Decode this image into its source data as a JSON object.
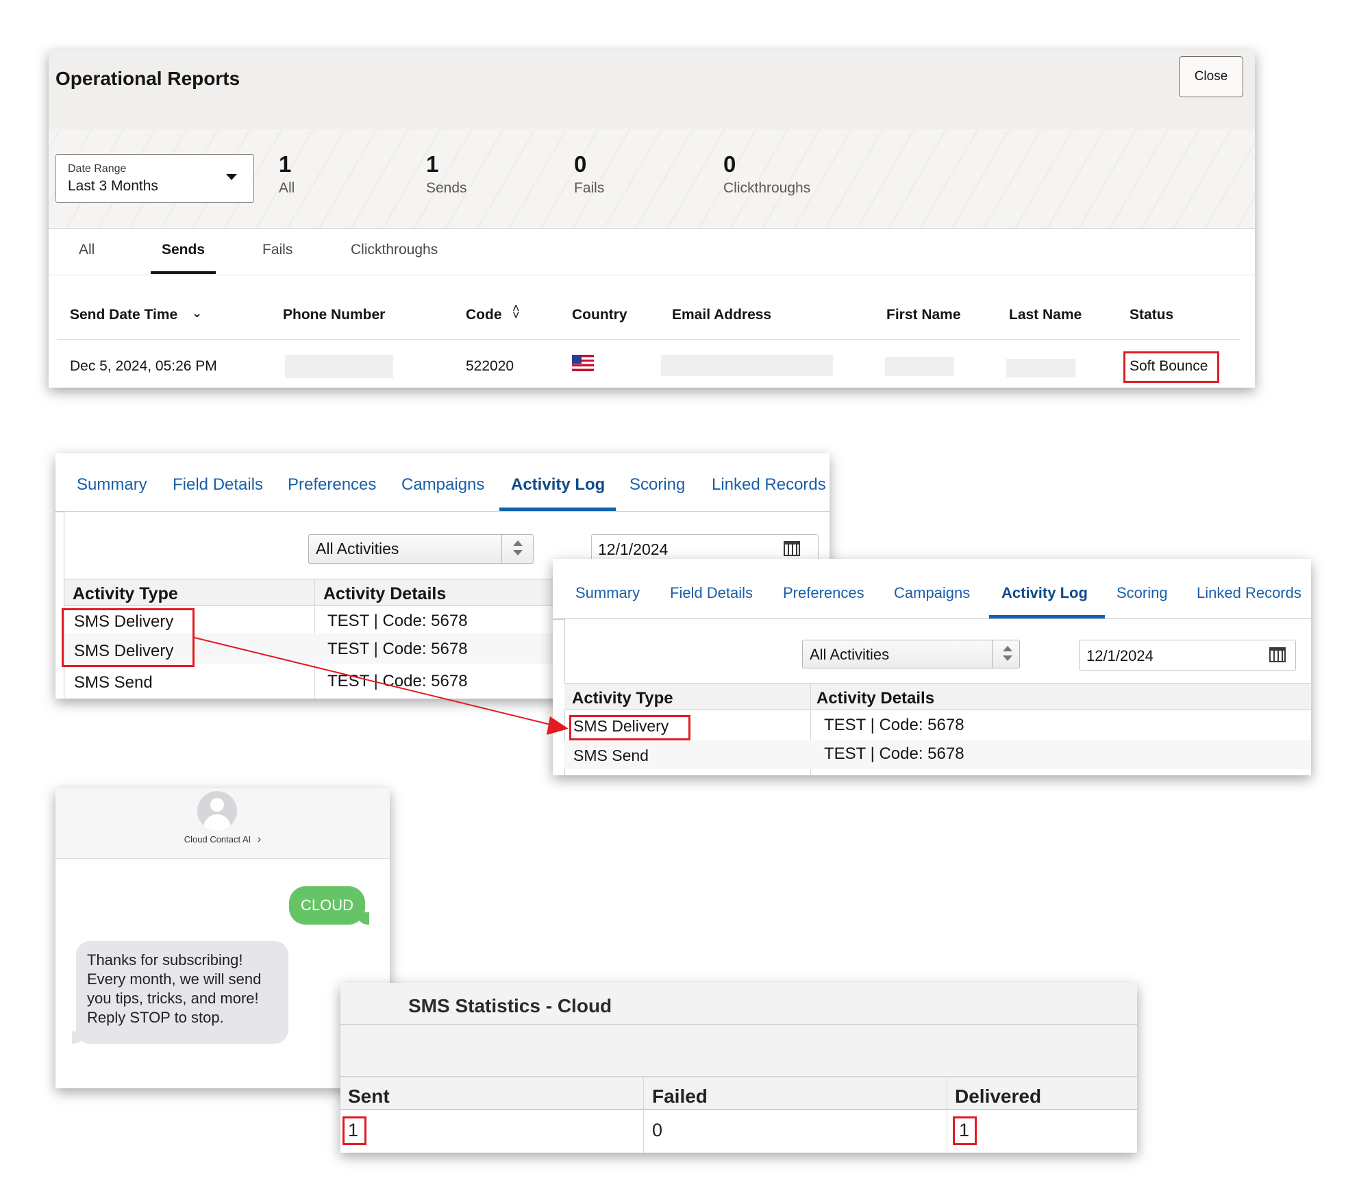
{
  "reports": {
    "title": "Operational Reports",
    "close_label": "Close",
    "date_range": {
      "label": "Date Range",
      "value": "Last 3 Months"
    },
    "metrics": [
      {
        "value": "1",
        "label": "All"
      },
      {
        "value": "1",
        "label": "Sends"
      },
      {
        "value": "0",
        "label": "Fails"
      },
      {
        "value": "0",
        "label": "Clickthroughs"
      }
    ],
    "tabs": [
      "All",
      "Sends",
      "Fails",
      "Clickthroughs"
    ],
    "active_tab": "Sends",
    "columns": [
      "Send Date Time",
      "Phone Number",
      "Code",
      "Country",
      "Email Address",
      "First Name",
      "Last Name",
      "Status"
    ],
    "row": {
      "send_date_time": "Dec 5, 2024, 05:26 PM",
      "code": "522020",
      "country_icon": "us-flag-icon",
      "status": "Soft Bounce"
    },
    "highlight_color": "#e11b22"
  },
  "activity_log_a": {
    "tabs": [
      "Summary",
      "Field Details",
      "Preferences",
      "Campaigns",
      "Activity Log",
      "Scoring",
      "Linked Records"
    ],
    "active_tab": "Activity Log",
    "filter": "All Activities",
    "date": "12/1/2024",
    "columns": [
      "Activity Type",
      "Activity Details"
    ],
    "rows": [
      {
        "type": "SMS Delivery",
        "details": "TEST | Code: 5678"
      },
      {
        "type": "SMS Delivery",
        "details": "TEST | Code: 5678"
      },
      {
        "type": "SMS Send",
        "details": "TEST | Code: 5678"
      }
    ]
  },
  "activity_log_b": {
    "tabs": [
      "Summary",
      "Field Details",
      "Preferences",
      "Campaigns",
      "Activity Log",
      "Scoring",
      "Linked Records"
    ],
    "active_tab": "Activity Log",
    "filter": "All Activities",
    "date": "12/1/2024",
    "columns": [
      "Activity Type",
      "Activity Details"
    ],
    "rows": [
      {
        "type": "SMS Delivery",
        "details": "TEST | Code: 5678"
      },
      {
        "type": "SMS Send",
        "details": "TEST | Code: 5678"
      }
    ]
  },
  "phone": {
    "contact": "Cloud Contact AI",
    "outgoing": "CLOUD",
    "incoming": "Thanks for subscribing!\nEvery month, we will send\nyou tips, tricks, and more!\nReply STOP to stop.",
    "bubble_green": "#65c466"
  },
  "sms_stats": {
    "title": "SMS Statistics - Cloud",
    "columns": [
      "Sent",
      "Failed",
      "Delivered"
    ],
    "values": [
      "1",
      "0",
      "1"
    ]
  }
}
